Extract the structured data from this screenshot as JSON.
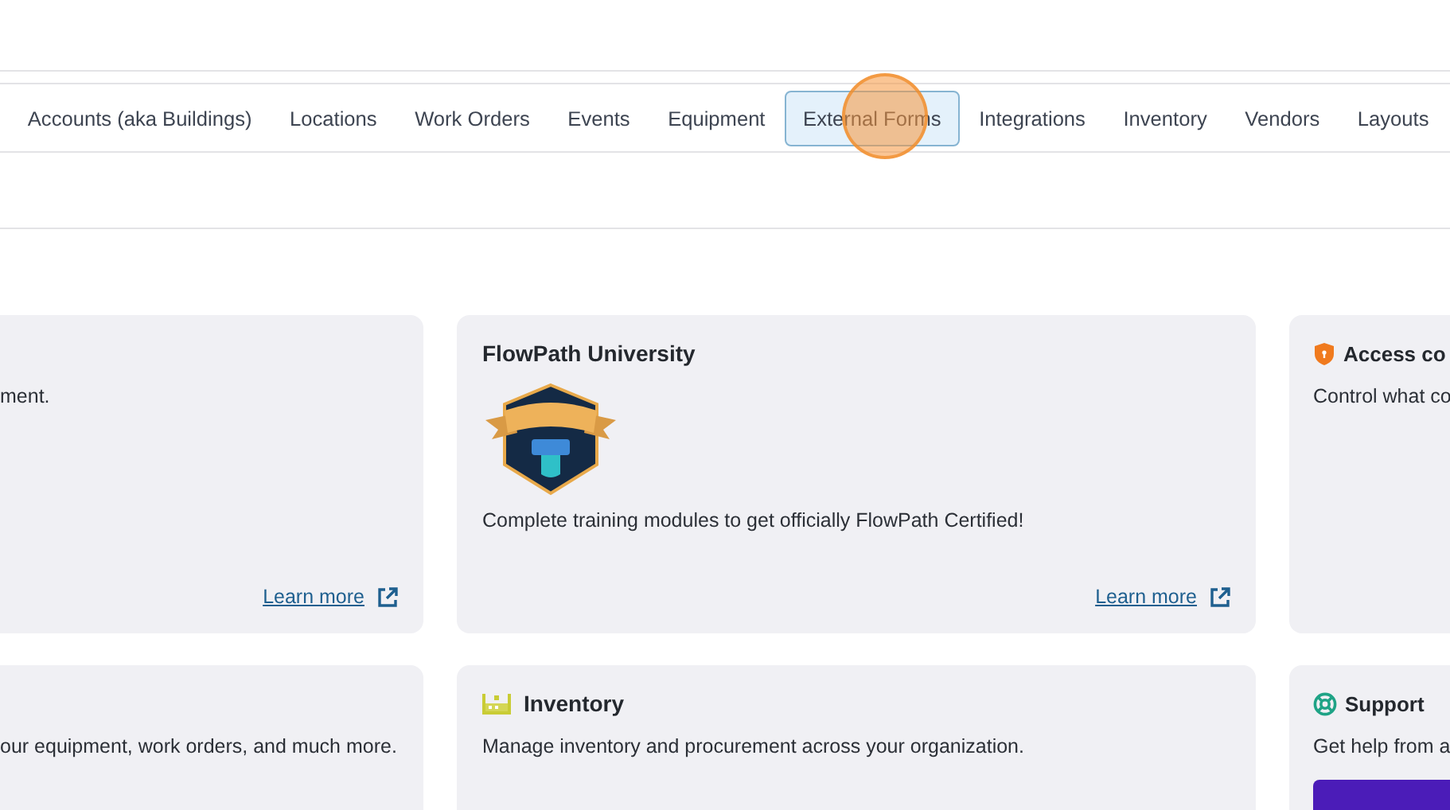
{
  "nav_tabs": [
    {
      "label": "Accounts (aka Buildings)",
      "selected": false,
      "clicked": false
    },
    {
      "label": "Locations",
      "selected": false,
      "clicked": false
    },
    {
      "label": "Work Orders",
      "selected": false,
      "clicked": false
    },
    {
      "label": "Events",
      "selected": false,
      "clicked": false
    },
    {
      "label": "Equipment",
      "selected": false,
      "clicked": false
    },
    {
      "label": "External Forms",
      "selected": true,
      "clicked": true
    },
    {
      "label": "Integrations",
      "selected": false,
      "clicked": false
    },
    {
      "label": "Inventory",
      "selected": false,
      "clicked": false
    },
    {
      "label": "Vendors",
      "selected": false,
      "clicked": false
    },
    {
      "label": "Layouts",
      "selected": false,
      "clicked": false
    }
  ],
  "cards": [
    {
      "kind": "plain",
      "description": "ment.",
      "link": "Learn more"
    },
    {
      "kind": "badge",
      "title": "FlowPath University",
      "description": "Complete training modules to get officially FlowPath Certified!",
      "link": "Learn more"
    },
    {
      "kind": "shield",
      "title": "Access co",
      "description": "Control what co"
    },
    {
      "kind": "plain",
      "description": "our equipment, work orders, and much more."
    },
    {
      "kind": "inventory",
      "title": "Inventory",
      "description": "Manage inventory and procurement across your organization."
    },
    {
      "kind": "support",
      "title": "Support",
      "description": "Get help from a",
      "button": {
        "kind": "primary"
      }
    }
  ]
}
